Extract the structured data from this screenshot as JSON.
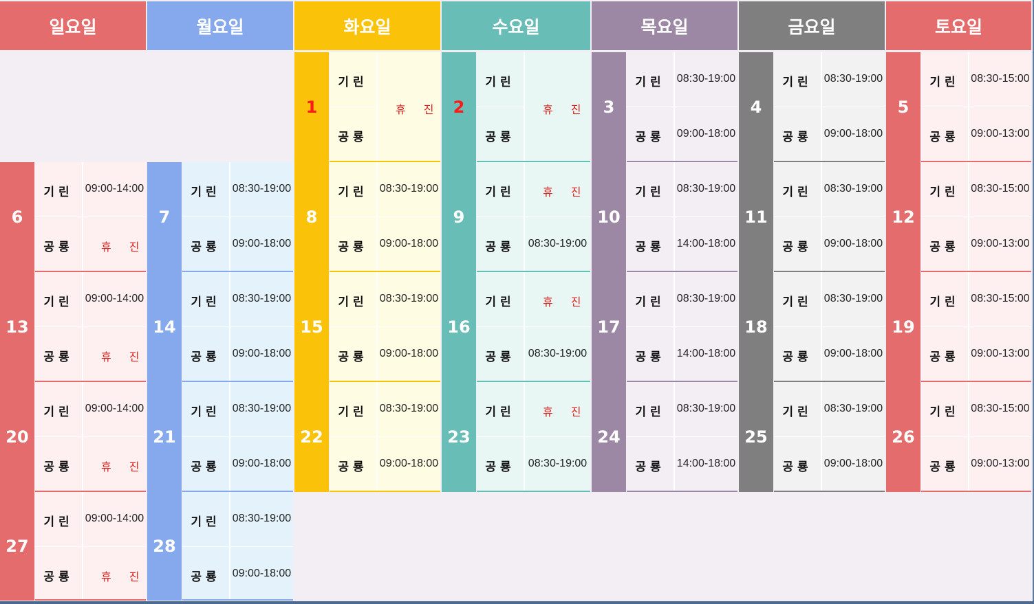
{
  "colors": {
    "sun": "#e46c6c",
    "mon": "#85a9ec",
    "tue": "#fbc20a",
    "wed": "#68bdb6",
    "thu": "#9c88a4",
    "fri": "#7f7f7f",
    "sat": "#e46c6c",
    "sun_bg": "#fef0f0",
    "mon_bg": "#e4f3fb",
    "tue_bg": "#fffce4",
    "wed_bg": "#e8f6f4",
    "thu_bg": "#f3eef4",
    "fri_bg": "#f2f2f2",
    "sat_bg": "#fef0f0",
    "page_bg": "#f3eef4"
  },
  "weekdays": [
    "일요일",
    "월요일",
    "화요일",
    "수요일",
    "목요일",
    "금요일",
    "토요일"
  ],
  "branches": {
    "a": "기린",
    "b": "공룡"
  },
  "days": [
    {
      "day": "1",
      "col": 2,
      "row": 0,
      "a": "",
      "b": "",
      "closed_mid": "휴진",
      "red": true
    },
    {
      "day": "2",
      "col": 3,
      "row": 0,
      "a": "",
      "b": "",
      "closed_mid": "휴진",
      "red": true
    },
    {
      "day": "3",
      "col": 4,
      "row": 0,
      "a": "08:30-19:00",
      "b": "09:00-18:00"
    },
    {
      "day": "4",
      "col": 5,
      "row": 0,
      "a": "08:30-19:00",
      "b": "09:00-18:00"
    },
    {
      "day": "5",
      "col": 6,
      "row": 0,
      "a": "08:30-15:00",
      "b": "09:00-13:00"
    },
    {
      "day": "6",
      "col": 0,
      "row": 1,
      "a": "09:00-14:00",
      "b": "휴진"
    },
    {
      "day": "7",
      "col": 1,
      "row": 1,
      "a": "08:30-19:00",
      "b": "09:00-18:00"
    },
    {
      "day": "8",
      "col": 2,
      "row": 1,
      "a": "08:30-19:00",
      "b": "09:00-18:00"
    },
    {
      "day": "9",
      "col": 3,
      "row": 1,
      "a": "휴진",
      "b": "08:30-19:00"
    },
    {
      "day": "10",
      "col": 4,
      "row": 1,
      "a": "08:30-19:00",
      "b": "14:00-18:00"
    },
    {
      "day": "11",
      "col": 5,
      "row": 1,
      "a": "08:30-19:00",
      "b": "09:00-18:00"
    },
    {
      "day": "12",
      "col": 6,
      "row": 1,
      "a": "08:30-15:00",
      "b": "09:00-13:00"
    },
    {
      "day": "13",
      "col": 0,
      "row": 2,
      "a": "09:00-14:00",
      "b": "휴진"
    },
    {
      "day": "14",
      "col": 1,
      "row": 2,
      "a": "08:30-19:00",
      "b": "09:00-18:00"
    },
    {
      "day": "15",
      "col": 2,
      "row": 2,
      "a": "08:30-19:00",
      "b": "09:00-18:00"
    },
    {
      "day": "16",
      "col": 3,
      "row": 2,
      "a": "휴진",
      "b": "08:30-19:00"
    },
    {
      "day": "17",
      "col": 4,
      "row": 2,
      "a": "08:30-19:00",
      "b": "14:00-18:00"
    },
    {
      "day": "18",
      "col": 5,
      "row": 2,
      "a": "08:30-19:00",
      "b": "09:00-18:00"
    },
    {
      "day": "19",
      "col": 6,
      "row": 2,
      "a": "08:30-15:00",
      "b": "09:00-13:00"
    },
    {
      "day": "20",
      "col": 0,
      "row": 3,
      "a": "09:00-14:00",
      "b": "휴진"
    },
    {
      "day": "21",
      "col": 1,
      "row": 3,
      "a": "08:30-19:00",
      "b": "09:00-18:00"
    },
    {
      "day": "22",
      "col": 2,
      "row": 3,
      "a": "08:30-19:00",
      "b": "09:00-18:00"
    },
    {
      "day": "23",
      "col": 3,
      "row": 3,
      "a": "휴진",
      "b": "08:30-19:00"
    },
    {
      "day": "24",
      "col": 4,
      "row": 3,
      "a": "08:30-19:00",
      "b": "14:00-18:00"
    },
    {
      "day": "25",
      "col": 5,
      "row": 3,
      "a": "08:30-19:00",
      "b": "09:00-18:00"
    },
    {
      "day": "26",
      "col": 6,
      "row": 3,
      "a": "08:30-15:00",
      "b": "09:00-13:00"
    },
    {
      "day": "27",
      "col": 0,
      "row": 4,
      "a": "09:00-14:00",
      "b": "휴진"
    },
    {
      "day": "28",
      "col": 1,
      "row": 4,
      "a": "08:30-19:00",
      "b": "09:00-18:00"
    }
  ]
}
